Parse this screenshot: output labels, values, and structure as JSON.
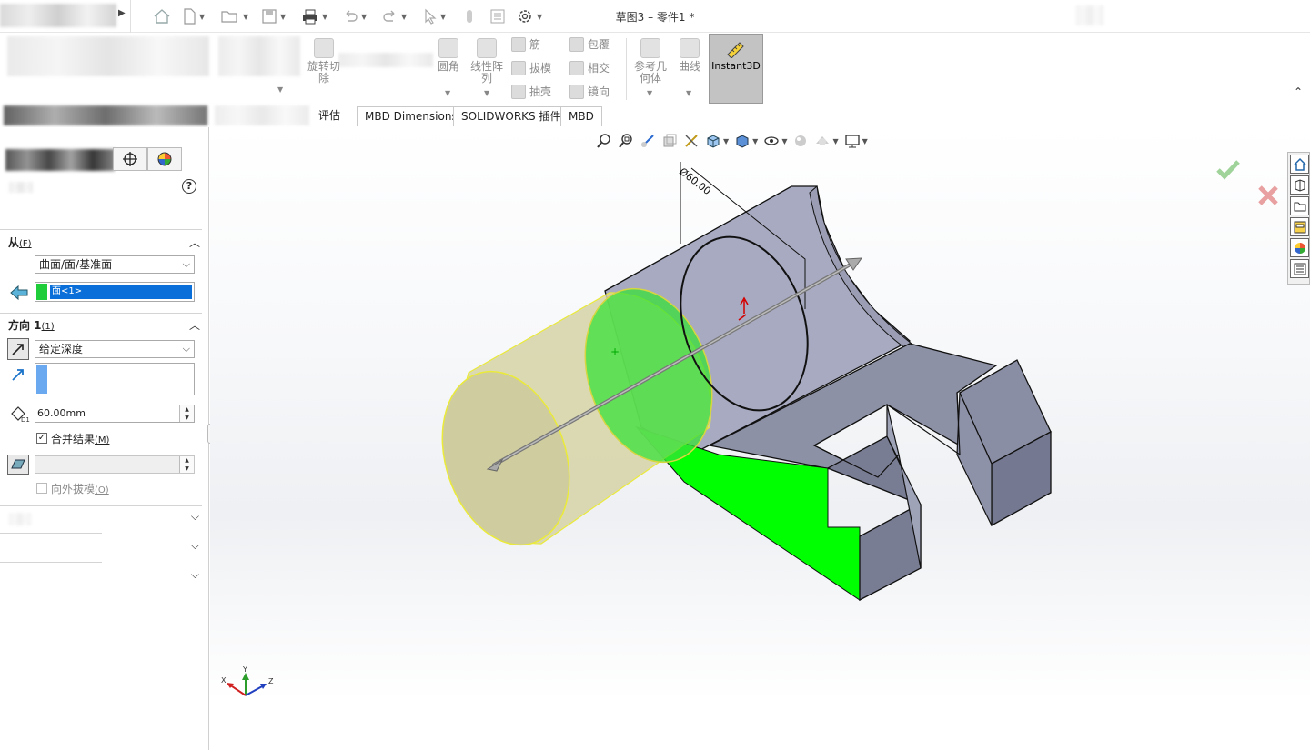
{
  "window": {
    "title": "草图3 – 零件1 *"
  },
  "ribbon": {
    "revolve_cut_label": "旋转切除",
    "fillet_label": "圆角",
    "linear_pattern_label": "线性阵列",
    "rib_label": "筋",
    "draft_label": "拔模",
    "shell_label": "抽壳",
    "wrap_label": "包覆",
    "intersect_label": "相交",
    "mirror_label": "镜向",
    "ref_geometry_label": "参考几何体",
    "curves_label": "曲线",
    "instant3d_label": "Instant3D"
  },
  "tabs": [
    {
      "label": "评估"
    },
    {
      "label": "MBD Dimensions"
    },
    {
      "label": "SOLIDWORKS 插件"
    },
    {
      "label": "MBD"
    }
  ],
  "property_manager": {
    "help_icon": "help-icon",
    "from": {
      "header": "从",
      "hotkey": "(F)",
      "start_condition": "曲面/面/基准面",
      "selection": "面<1>"
    },
    "direction1": {
      "header": "方向 1",
      "hotkey": "(1)",
      "end_condition": "给定深度",
      "depth": "60.00mm",
      "merge_result_label": "合并结果",
      "merge_hotkey": "(M)",
      "merge_checked": true,
      "draft_outward_label": "向外拔模",
      "draft_hotkey": "(O)",
      "draft_checked": false
    }
  },
  "viewport": {
    "dimension_label": "Ø60.00",
    "triad": {
      "x": "X",
      "y": "Y",
      "z": "Z"
    },
    "colors": {
      "preview": "#d6d3a6",
      "selected_face": "#00ff00",
      "model": "#8f93a6",
      "ok": "#5cb85c",
      "cancel": "#e06666"
    }
  }
}
